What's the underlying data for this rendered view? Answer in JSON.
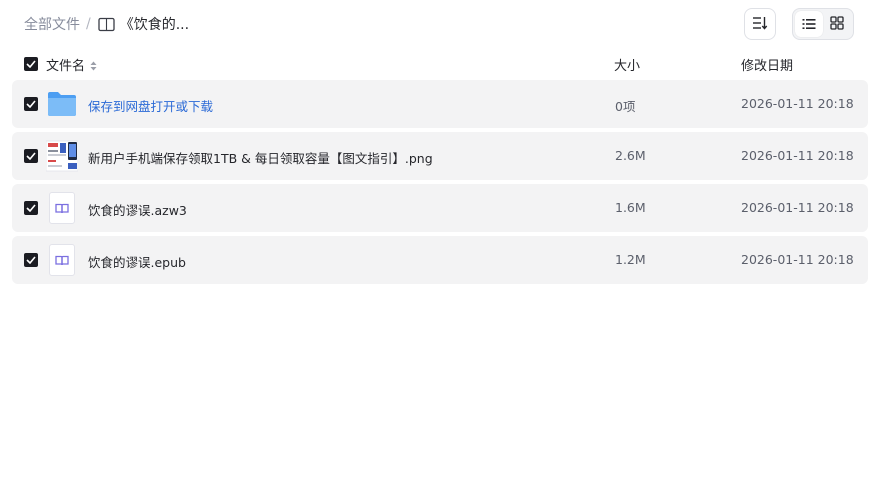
{
  "breadcrumb": {
    "root": "全部文件",
    "separator": "/",
    "current": "《饮食的..."
  },
  "toolbar": {
    "sort_icon": "sort-icon",
    "list_view_icon": "list-view-icon",
    "grid_view_icon": "grid-view-icon",
    "active_view": "list"
  },
  "columns": {
    "name": "文件名",
    "size": "大小",
    "date": "修改日期"
  },
  "files": [
    {
      "name": "保存到网盘打开或下载",
      "size": "0项",
      "date": "2026-01-11 20:18",
      "type": "folder",
      "checked": true
    },
    {
      "name": "新用户手机端保存领取1TB & 每日领取容量【图文指引】.png",
      "size": "2.6M",
      "date": "2026-01-11 20:18",
      "type": "image",
      "checked": true
    },
    {
      "name": "饮食的谬误.azw3",
      "size": "1.6M",
      "date": "2026-01-11 20:18",
      "type": "ebook",
      "checked": true
    },
    {
      "name": "饮食的谬误.epub",
      "size": "1.2M",
      "date": "2026-01-11 20:18",
      "type": "ebook",
      "checked": true
    }
  ],
  "colors": {
    "accent_link": "#2b6ad6",
    "folder": "#5aa9f5",
    "ebook_icon": "#7b6fe0",
    "row_bg": "#f3f3f4"
  }
}
